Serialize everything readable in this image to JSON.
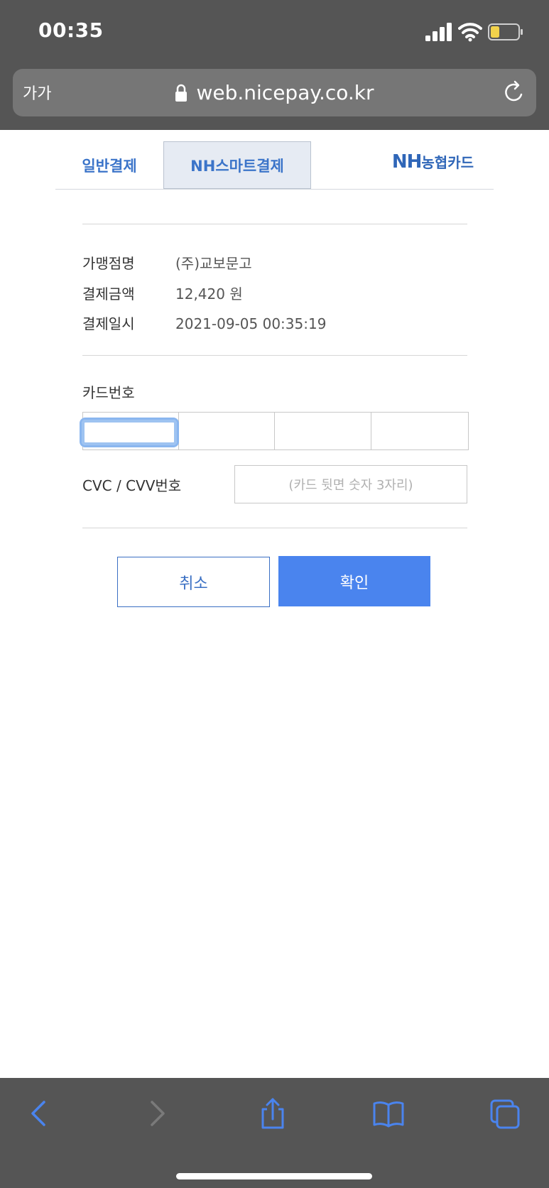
{
  "status_bar": {
    "time": "00:35",
    "icons": [
      "signal-icon",
      "wifi-icon",
      "battery-low-icon"
    ],
    "battery_color": "#f2d24b"
  },
  "address_bar": {
    "text_size_label": "가가",
    "url": "web.nicepay.co.kr",
    "icons": [
      "lock-icon",
      "reload-icon"
    ]
  },
  "tabs": {
    "general": "일반결제",
    "smart": "NH스마트결제",
    "brand_prefix": "NH",
    "brand_suffix": "농협카드"
  },
  "payment_info": [
    {
      "label": "가맹점명",
      "value": "(주)교보문고"
    },
    {
      "label": "결제금액",
      "value": "12,420 원"
    },
    {
      "label": "결제일시",
      "value": "2021-09-05 00:35:19"
    }
  ],
  "card_form": {
    "card_number_label": "카드번호",
    "card_number_values": [
      "",
      "",
      "",
      ""
    ],
    "cvc_label": "CVC / CVV번호",
    "cvc_placeholder": "(카드 뒷면 숫자 3자리)"
  },
  "buttons": {
    "cancel": "취소",
    "confirm": "확인"
  },
  "toolbar": {
    "icons": [
      "back-icon",
      "forward-icon",
      "share-icon",
      "bookmarks-icon",
      "tabs-icon"
    ]
  },
  "colors": {
    "accent": "#4a84ee",
    "tab_text": "#3b74c9",
    "chrome": "#555555"
  }
}
